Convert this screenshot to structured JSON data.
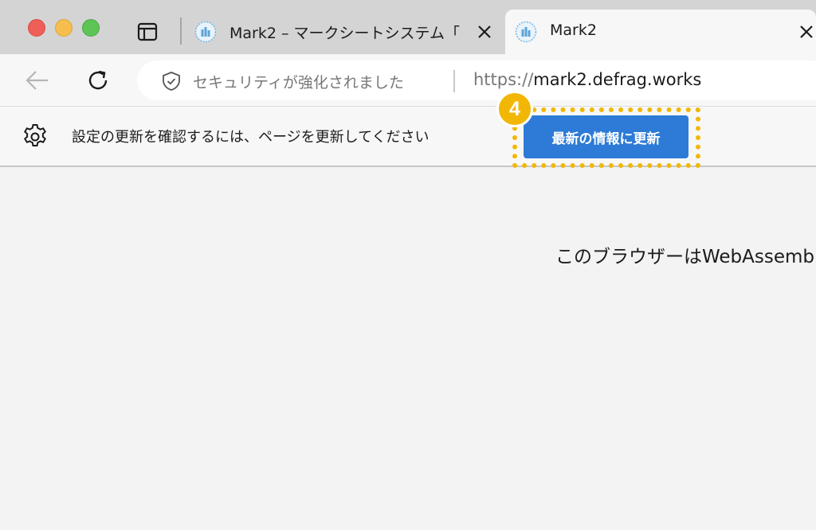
{
  "tabs": [
    {
      "title": "Mark2 – マークシートシステム「|",
      "active": false,
      "favicon": "mark2-favicon-icon"
    },
    {
      "title": "Mark2",
      "active": true,
      "favicon": "mark2-favicon-icon"
    }
  ],
  "address_bar": {
    "security_text": "セキュリティが強化されました",
    "url_scheme": "https://",
    "url_host": "mark2.defrag.works"
  },
  "info_bar": {
    "message": "設定の更新を確認するには、ページを更新してください",
    "button_label": "最新の情報に更新",
    "step_badge": "4"
  },
  "content": {
    "message": "このブラウザーはWebAssembly"
  },
  "colors": {
    "accent_button": "#2d7bd6",
    "highlight": "#f2b705"
  }
}
